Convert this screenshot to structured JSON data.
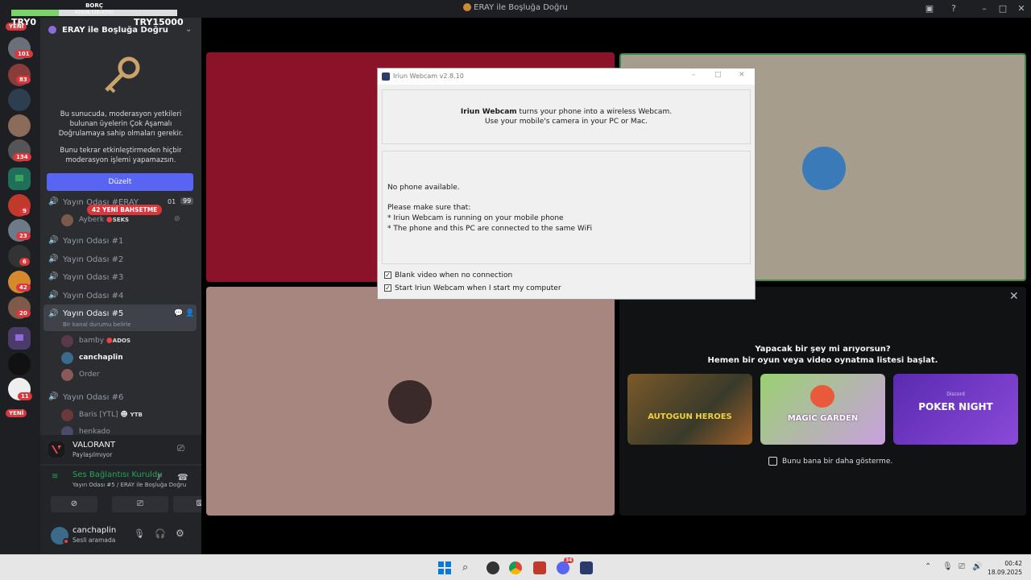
{
  "window": {
    "title": "ERAY ile Boşluğa Doğru"
  },
  "overlay": {
    "label_top": "BORÇ",
    "progress_text": "4260₺ (28.45%)",
    "progress_fraction": 0.2845,
    "left_label": "TRY0",
    "right_label": "TRY15000"
  },
  "rail": {
    "new_top": "YENİ",
    "new_bottom": "YENİ",
    "badges": [
      "101",
      "83",
      "134",
      "9",
      "23",
      "6",
      "42",
      "20",
      "11"
    ]
  },
  "server": {
    "name": "ERAY ile Boşluğa Doğru",
    "mod_notice_1": "Bu sunucuda, moderasyon yetkileri bulunan üyelerin Çok Aşamalı Doğrulamaya sahip olmaları gerekir.",
    "mod_notice_2": "Bunu tekrar etkinleştirmeden hiçbir moderasyon işlemi yapamazsın.",
    "edit_button": "Düzelt"
  },
  "channels": {
    "ch0": {
      "name": "Yayın Odası #ERAY",
      "count_a": "01",
      "count_b": "99"
    },
    "mention_pill": "42 YENİ BAHSETME",
    "ch0_user": {
      "name": "Ayberk",
      "tag": "SEKS"
    },
    "ch1": "Yayın Odası #1",
    "ch2": "Yayın Odası #2",
    "ch3": "Yayın Odası #3",
    "ch4": "Yayın Odası #4",
    "ch5": {
      "name": "Yayın Odası #5",
      "status": "Bir kanal durumu belirle"
    },
    "ch5_users": [
      {
        "name": "bamby",
        "tag": "ADOS"
      },
      {
        "name": "canchaplin",
        "tag": ""
      },
      {
        "name": "Order",
        "tag": ""
      }
    ],
    "ch6": "Yayın Odası #6",
    "ch6_users": [
      {
        "name": "Baris [YTL]",
        "tag": "YTB"
      },
      {
        "name": "henkado",
        "tag": ""
      }
    ]
  },
  "activity": {
    "game": "VALORANT",
    "status": "Paylaşılmıyor"
  },
  "voice": {
    "status": "Ses Bağlantısı Kuruldu",
    "location": "Yayın Odası #5 / ERAY ile Boşluğa Doğru"
  },
  "user": {
    "name": "canchaplin",
    "status": "Sesli aramada"
  },
  "dialog": {
    "title": "Iriun Webcam v2.8.10",
    "brand": "Iriun Webcam",
    "intro_rest": " turns your phone into a wireless Webcam.",
    "intro_line2": "Use your mobile's camera in your PC or Mac.",
    "no_phone": "No phone available.",
    "make_sure": "Please make sure that:",
    "bullet1": "* Iriun Webcam is running on your mobile phone",
    "bullet2": "* The phone and this PC are connected to the same WiFi",
    "check1": "Blank video when no connection",
    "check2": "Start Iriun Webcam when I start my computer"
  },
  "activities_panel": {
    "line1": "Yapacak bir şey mi arıyorsun?",
    "line2": "Hemen bir oyun veya video oynatma listesi başlat.",
    "games": [
      "AUTOGUN HEROES",
      "MAGIC GARDEN",
      "POKER NIGHT"
    ],
    "poker_brand": "Discord",
    "dont_show": "Bunu bana bir daha gösterme."
  },
  "taskbar": {
    "time": "00:42",
    "date": "18.09.2025",
    "discord_badge": "34"
  },
  "colors": {
    "tile_red": "#8b1329",
    "tile_beige": "#a79d8d",
    "tile_pink": "#a6867f",
    "accent": "#5865f2",
    "voice_green": "#23a559"
  }
}
